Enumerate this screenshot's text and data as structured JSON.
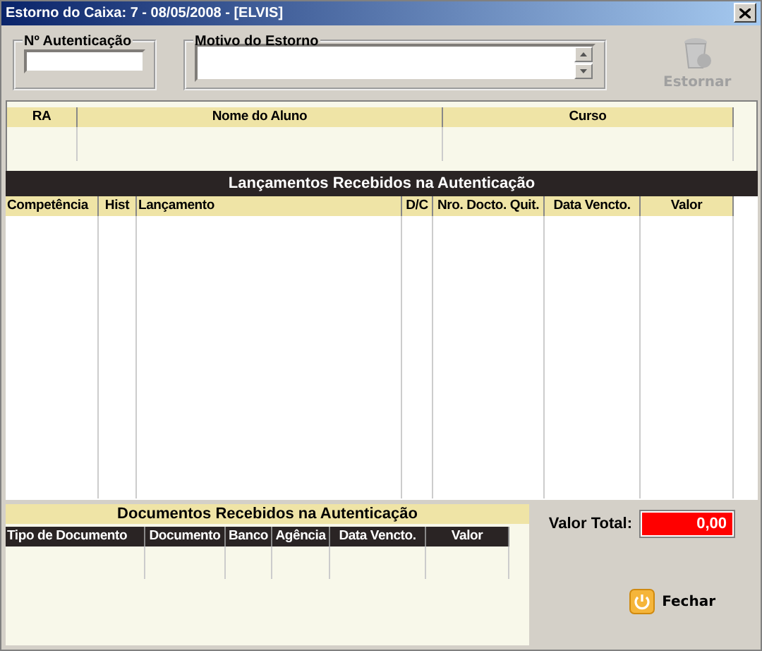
{
  "window": {
    "title": "Estorno do Caixa: 7 - 08/05/2008 - [ELVIS]"
  },
  "autenticacao": {
    "label": "Nº Autenticação"
  },
  "motivo": {
    "label": "Motivo do Estorno"
  },
  "estornar_button": {
    "label": "Estornar",
    "disabled": true
  },
  "alunos_table": {
    "columns": [
      "RA",
      "Nome do Aluno",
      "Curso"
    ]
  },
  "lancamentos": {
    "title": "Lançamentos Recebidos na Autenticação",
    "columns": [
      "Competência",
      "Hist",
      "Lançamento",
      "D/C",
      "Nro. Docto. Quit.",
      "Data Vencto.",
      "Valor"
    ]
  },
  "documentos": {
    "title": "Documentos Recebidos na Autenticação",
    "columns": [
      "Tipo de Documento",
      "Documento",
      "Banco",
      "Agência",
      "Data Vencto.",
      "Valor"
    ]
  },
  "valor_total": {
    "label": "Valor Total:",
    "value": "0,00"
  },
  "fechar_button": {
    "label": "Fechar",
    "disabled": false
  }
}
